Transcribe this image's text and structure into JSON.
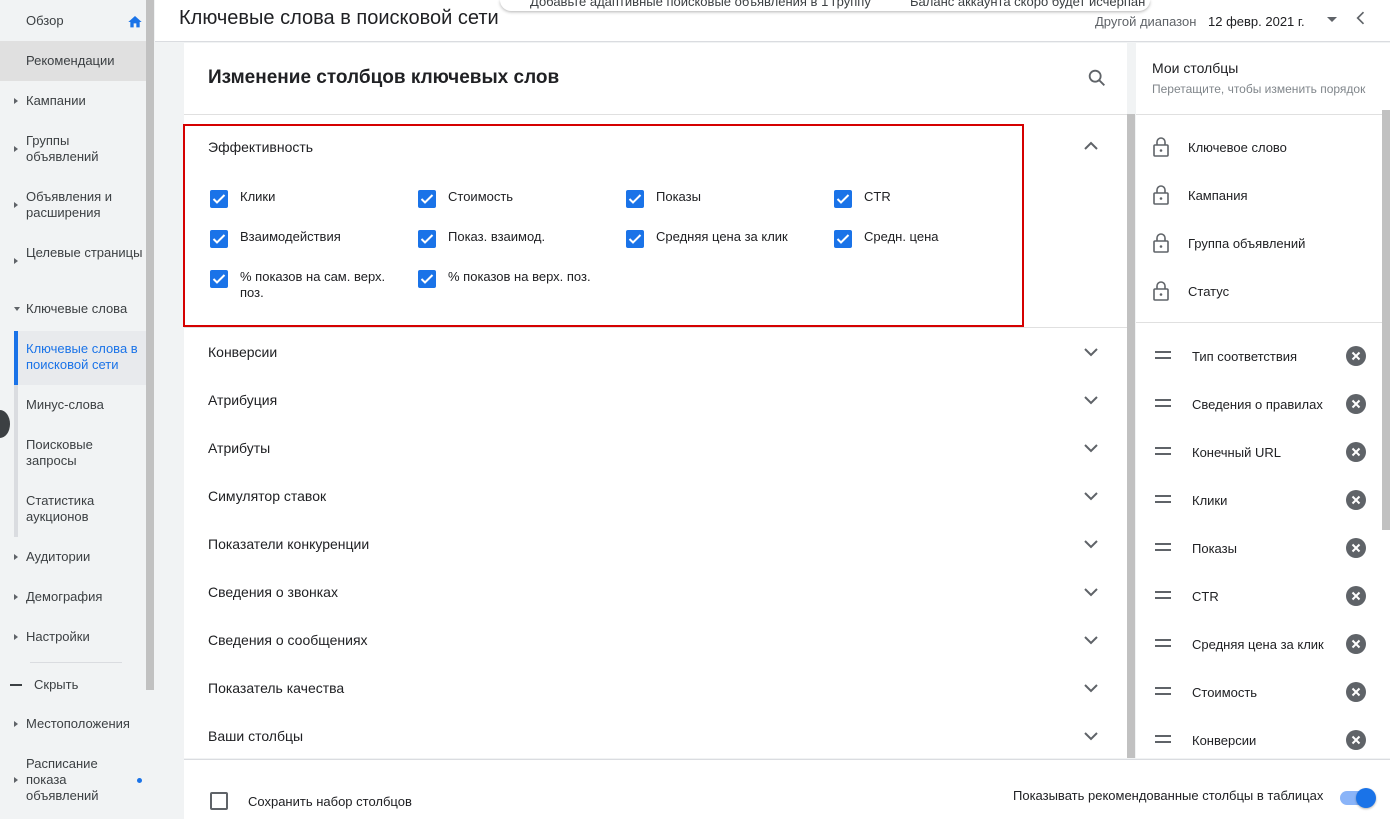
{
  "header": {
    "title": "Ключевые слова в поисковой сети",
    "date_range_label": "Другой диапазон",
    "date_value": "12 февр. 2021 г."
  },
  "notifications": {
    "left_text": "Добавьте адаптивные поисковые объявления в 1 группу",
    "right_text": "Баланс аккаунта скоро будет исчерпан"
  },
  "sidebar": {
    "items": [
      {
        "label": "Обзор"
      },
      {
        "label": "Рекомендации"
      },
      {
        "label": "Кампании"
      },
      {
        "label": "Группы объявлений"
      },
      {
        "label": "Объявления и расширения"
      },
      {
        "label": "Целевые страницы"
      },
      {
        "label": "Ключевые слова"
      },
      {
        "label": "Ключевые слова в поисковой сети"
      },
      {
        "label": "Минус-слова"
      },
      {
        "label": "Поисковые запросы"
      },
      {
        "label": "Статистика аукционов"
      },
      {
        "label": "Аудитории"
      },
      {
        "label": "Демография"
      },
      {
        "label": "Настройки"
      },
      {
        "label": "Скрыть"
      },
      {
        "label": "Местоположения"
      },
      {
        "label": "Расписание показа объявлений"
      }
    ]
  },
  "panel": {
    "title": "Изменение столбцов ключевых слов",
    "performance": {
      "title": "Эффективность",
      "checkboxes": [
        {
          "label": "Клики",
          "checked": true
        },
        {
          "label": "Стоимость",
          "checked": true
        },
        {
          "label": "Показы",
          "checked": true
        },
        {
          "label": "CTR",
          "checked": true
        },
        {
          "label": "Взаимодействия",
          "checked": true
        },
        {
          "label": "Показ. взаимод.",
          "checked": true
        },
        {
          "label": "Средняя цена за клик",
          "checked": true
        },
        {
          "label": "Средн. цена",
          "checked": true
        },
        {
          "label": "% показов на сам. верх. поз.",
          "checked": true
        },
        {
          "label": "% показов на верх. поз.",
          "checked": true
        }
      ]
    },
    "sections": [
      {
        "label": "Конверсии"
      },
      {
        "label": "Атрибуция"
      },
      {
        "label": "Атрибуты"
      },
      {
        "label": "Симулятор ставок"
      },
      {
        "label": "Показатели конкуренции"
      },
      {
        "label": "Сведения о звонках"
      },
      {
        "label": "Сведения о сообщениях"
      },
      {
        "label": "Показатель качества"
      },
      {
        "label": "Ваши столбцы"
      }
    ]
  },
  "my_columns": {
    "title": "Мои столбцы",
    "subtitle": "Перетащите, чтобы изменить порядок",
    "locked": [
      {
        "label": "Ключевое слово"
      },
      {
        "label": "Кампания"
      },
      {
        "label": "Группа объявлений"
      },
      {
        "label": "Статус"
      }
    ],
    "movable": [
      {
        "label": "Тип соответствия"
      },
      {
        "label": "Сведения о правилах"
      },
      {
        "label": "Конечный URL"
      },
      {
        "label": "Клики"
      },
      {
        "label": "Показы"
      },
      {
        "label": "CTR"
      },
      {
        "label": "Средняя цена за клик"
      },
      {
        "label": "Стоимость"
      },
      {
        "label": "Конверсии"
      }
    ]
  },
  "footer": {
    "save_set_label": "Сохранить набор столбцов",
    "save_set_checked": false,
    "show_recommended_label": "Показывать рекомендованные столбцы в таблицах",
    "show_recommended_on": true
  },
  "colors": {
    "accent": "#1a73e8",
    "highlight_border": "#d50000"
  }
}
